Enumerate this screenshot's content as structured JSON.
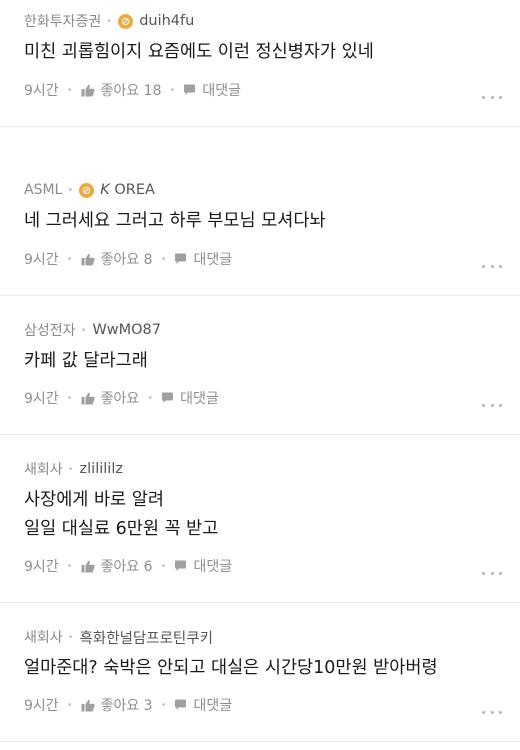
{
  "comments": [
    {
      "company": "한화투자증권",
      "nickname": "duih4fu",
      "badge": true,
      "lines": [
        "미친 괴롭힘이지 요즘에도 이런 정신병자가 있네"
      ],
      "time": "9시간",
      "like_label": "좋아요 18",
      "reply_label": "대댓글"
    },
    {
      "company": "ASML",
      "nickname_prefix": "K",
      "nickname": "OREA",
      "badge": true,
      "lines": [
        "네 그러세요 그러고 하루 부모님 모셔다놔"
      ],
      "time": "9시간",
      "like_label": "좋아요 8",
      "reply_label": "대댓글"
    },
    {
      "company": "삼성전자",
      "nickname": "WwMO87",
      "badge": false,
      "lines": [
        "카페 값 달라그래"
      ],
      "time": "9시간",
      "like_label": "좋아요",
      "reply_label": "대댓글"
    },
    {
      "company": "새회사",
      "nickname": "zlilililz",
      "badge": false,
      "lines": [
        "사장에게 바로 알려",
        "일일 대실료 6만원 꼭 받고"
      ],
      "time": "9시간",
      "like_label": "좋아요 6",
      "reply_label": "대댓글"
    },
    {
      "company": "새회사",
      "nickname": "흑화한널담프로틴쿠키",
      "badge": false,
      "lines": [
        "얼마준대? 숙박은 안되고 대실은 시간당10만원 받아버령"
      ],
      "time": "9시간",
      "like_label": "좋아요 3",
      "reply_label": "대댓글"
    }
  ],
  "colors": {
    "badge": "#f0a93a",
    "meta_text": "#8a8a8a",
    "divider": "#ebebeb"
  }
}
